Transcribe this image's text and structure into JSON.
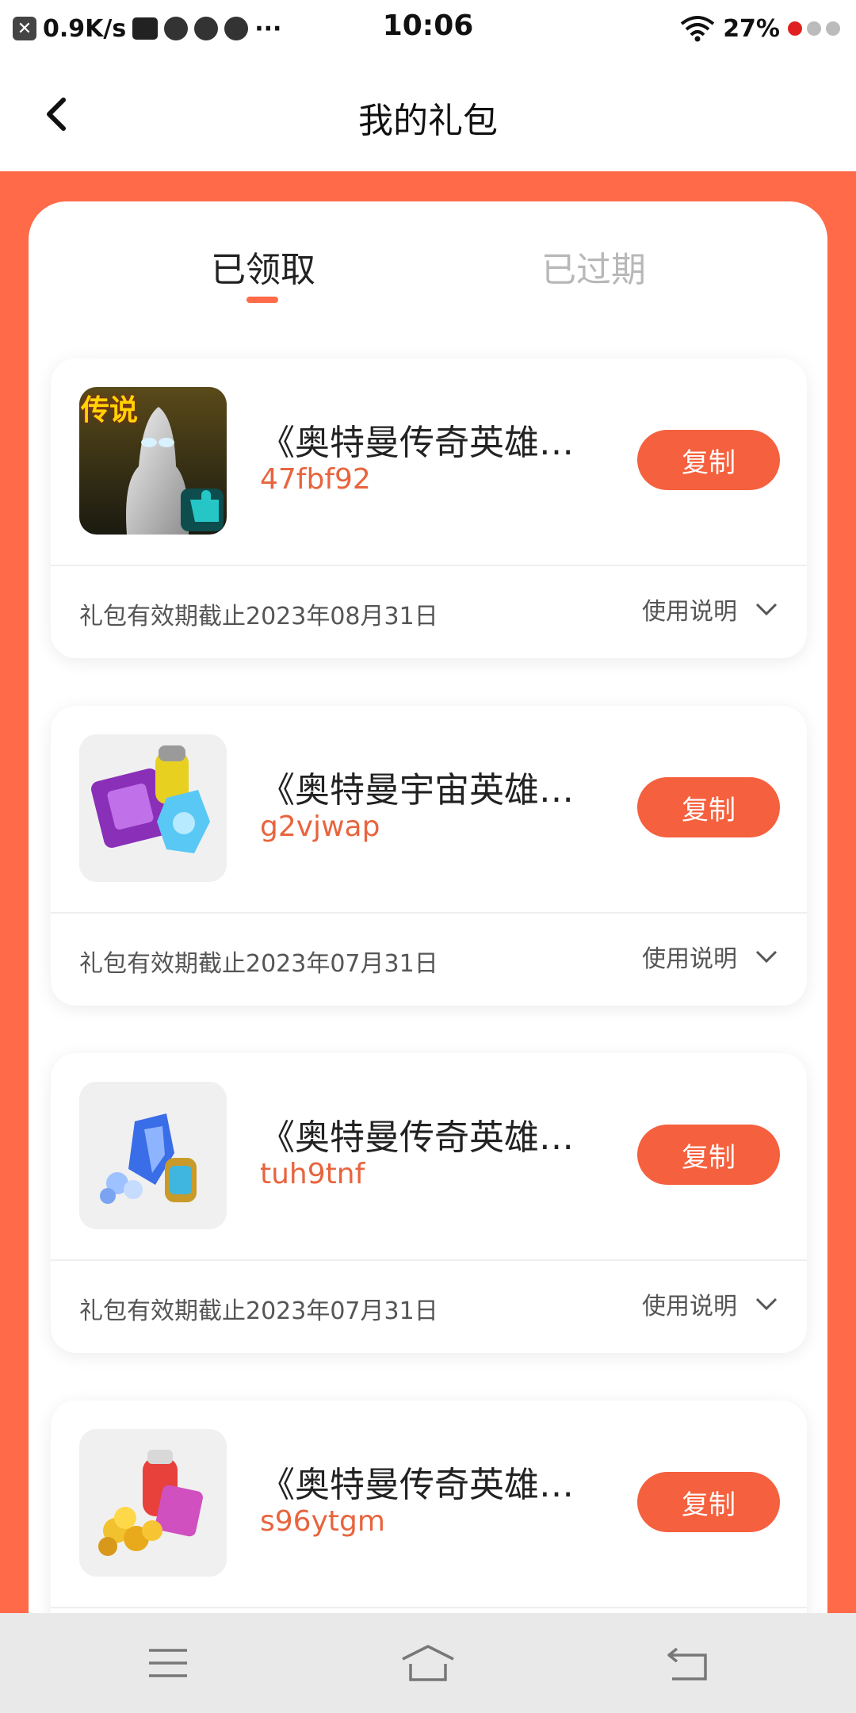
{
  "status_bar": {
    "speed": "0.9K/s",
    "more": "···",
    "time": "10:06",
    "battery": "27%"
  },
  "header": {
    "title": "我的礼包"
  },
  "tabs": [
    {
      "label": "已领取"
    },
    {
      "label": "已过期"
    }
  ],
  "gifts": [
    {
      "title": "《奥特曼传奇英雄》礼包",
      "code": "47fbf92",
      "copy_label": "复制",
      "expiry": "礼包有效期截止2023年08月31日",
      "usage_label": "使用说明",
      "thumb_text": "传说"
    },
    {
      "title": "《奥特曼宇宙英雄》礼包",
      "code": "g2vjwap",
      "copy_label": "复制",
      "expiry": "礼包有效期截止2023年07月31日",
      "usage_label": "使用说明"
    },
    {
      "title": "《奥特曼传奇英雄》礼包",
      "code": "tuh9tnf",
      "copy_label": "复制",
      "expiry": "礼包有效期截止2023年07月31日",
      "usage_label": "使用说明"
    },
    {
      "title": "《奥特曼传奇英雄》礼包",
      "code": "s96ytgm",
      "copy_label": "复制",
      "expiry": "",
      "usage_label": ""
    }
  ],
  "colors": {
    "accent": "#ff6a48",
    "button": "#f5603e",
    "code_text": "#e8643e"
  }
}
